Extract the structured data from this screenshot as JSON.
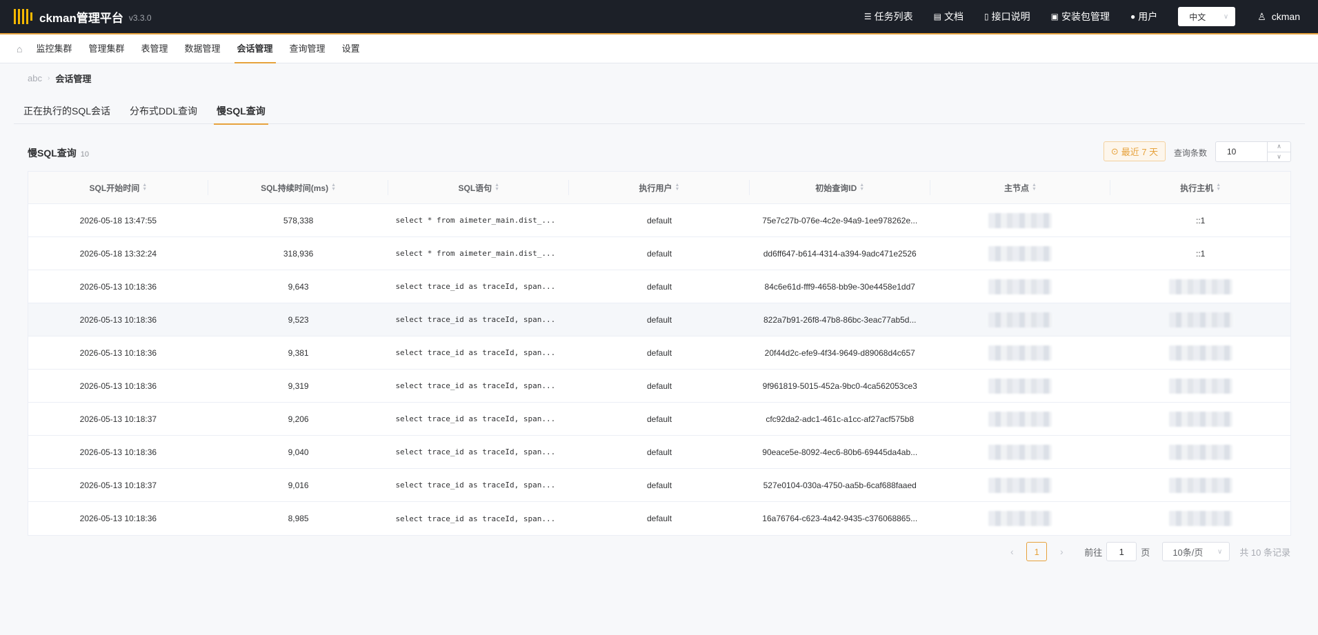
{
  "app": {
    "name": "ckman管理平台",
    "version": "v3.3.0"
  },
  "topnav": {
    "items": [
      {
        "label": "任务列表",
        "icon": "list-icon"
      },
      {
        "label": "文档",
        "icon": "book-icon"
      },
      {
        "label": "接口说明",
        "icon": "file-icon"
      },
      {
        "label": "安装包管理",
        "icon": "package-icon"
      },
      {
        "label": "用户",
        "icon": "users-icon"
      }
    ],
    "language": "中文",
    "username": "ckman"
  },
  "subnav": {
    "tabs": [
      "监控集群",
      "管理集群",
      "表管理",
      "数据管理",
      "会话管理",
      "查询管理",
      "设置"
    ],
    "active": "会话管理"
  },
  "breadcrumb": {
    "root": "abc",
    "current": "会话管理"
  },
  "session_tabs": {
    "tabs": [
      "正在执行的SQL会话",
      "分布式DDL查询",
      "慢SQL查询"
    ],
    "active": "慢SQL查询"
  },
  "panel": {
    "title": "慢SQL查询",
    "count": "10",
    "recent_button": "最近 7 天",
    "query_limit_label": "查询条数",
    "query_limit_value": "10"
  },
  "table": {
    "columns": [
      "SQL开始时间",
      "SQL持续时间(ms)",
      "SQL语句",
      "执行用户",
      "初始查询ID",
      "主节点",
      "执行主机"
    ],
    "rows": [
      {
        "start": "2026-05-18 13:47:55",
        "duration": "578,338",
        "sql": "select * from aimeter_main.dist_...",
        "user": "default",
        "query_id": "75e7c27b-076e-4c2e-94a9-1ee978262e...",
        "host": "::1",
        "host_blurred": false
      },
      {
        "start": "2026-05-18 13:32:24",
        "duration": "318,936",
        "sql": "select * from aimeter_main.dist_...",
        "user": "default",
        "query_id": "dd6ff647-b614-4314-a394-9adc471e2526",
        "host": "::1",
        "host_blurred": false
      },
      {
        "start": "2026-05-13 10:18:36",
        "duration": "9,643",
        "sql": "select trace_id as traceId, span...",
        "user": "default",
        "query_id": "84c6e61d-fff9-4658-bb9e-30e4458e1dd7",
        "host": "",
        "host_blurred": true
      },
      {
        "start": "2026-05-13 10:18:36",
        "duration": "9,523",
        "sql": "select trace_id as traceId, span...",
        "user": "default",
        "query_id": "822a7b91-26f8-47b8-86bc-3eac77ab5d...",
        "host": "",
        "host_blurred": true
      },
      {
        "start": "2026-05-13 10:18:36",
        "duration": "9,381",
        "sql": "select trace_id as traceId, span...",
        "user": "default",
        "query_id": "20f44d2c-efe9-4f34-9649-d89068d4c657",
        "host": "",
        "host_blurred": true
      },
      {
        "start": "2026-05-13 10:18:36",
        "duration": "9,319",
        "sql": "select trace_id as traceId, span...",
        "user": "default",
        "query_id": "9f961819-5015-452a-9bc0-4ca562053ce3",
        "host": "",
        "host_blurred": true
      },
      {
        "start": "2026-05-13 10:18:37",
        "duration": "9,206",
        "sql": "select trace_id as traceId, span...",
        "user": "default",
        "query_id": "cfc92da2-adc1-461c-a1cc-af27acf575b8",
        "host": "",
        "host_blurred": true
      },
      {
        "start": "2026-05-13 10:18:36",
        "duration": "9,040",
        "sql": "select trace_id as traceId, span...",
        "user": "default",
        "query_id": "90eace5e-8092-4ec6-80b6-69445da4ab...",
        "host": "",
        "host_blurred": true
      },
      {
        "start": "2026-05-13 10:18:37",
        "duration": "9,016",
        "sql": "select trace_id as traceId, span...",
        "user": "default",
        "query_id": "527e0104-030a-4750-aa5b-6caf688faaed",
        "host": "",
        "host_blurred": true
      },
      {
        "start": "2026-05-13 10:18:36",
        "duration": "8,985",
        "sql": "select trace_id as traceId, span...",
        "user": "default",
        "query_id": "16a76764-c623-4a42-9435-c376068865...",
        "host": "",
        "host_blurred": true
      }
    ]
  },
  "pagination": {
    "current_page": "1",
    "goto_label": "前往",
    "goto_value": "1",
    "page_suffix": "页",
    "page_size": "10条/页",
    "total": "共 10 条记录"
  },
  "colors": {
    "accent": "#e6a23c",
    "topbar_bg": "#1c2028",
    "logo": "#f5b800"
  }
}
